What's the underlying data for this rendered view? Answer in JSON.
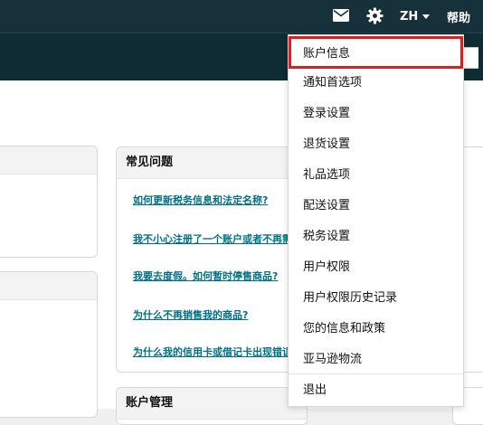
{
  "header": {
    "language": "ZH",
    "help": "帮助"
  },
  "faq": {
    "title": "常见问题",
    "links": [
      "如何更新税务信息和法定名称?",
      "我不小心注册了一个账户或者不再需",
      "我要去度假。如何暂时停售商品?",
      "为什么不再销售我的商品?",
      "为什么我的信用卡或借记卡出现错误"
    ]
  },
  "account_card": {
    "title": "账户管理"
  },
  "dropdown": {
    "items": [
      "账户信息",
      "通知首选项",
      "登录设置",
      "退货设置",
      "礼品选项",
      "配送设置",
      "税务设置",
      "用户权限",
      "用户权限历史记录",
      "您的信息和政策",
      "亚马逊物流",
      "退出"
    ],
    "highlight_color": "#e31b1b"
  },
  "colors": {
    "topbar": "#17313a",
    "link": "#007185"
  }
}
